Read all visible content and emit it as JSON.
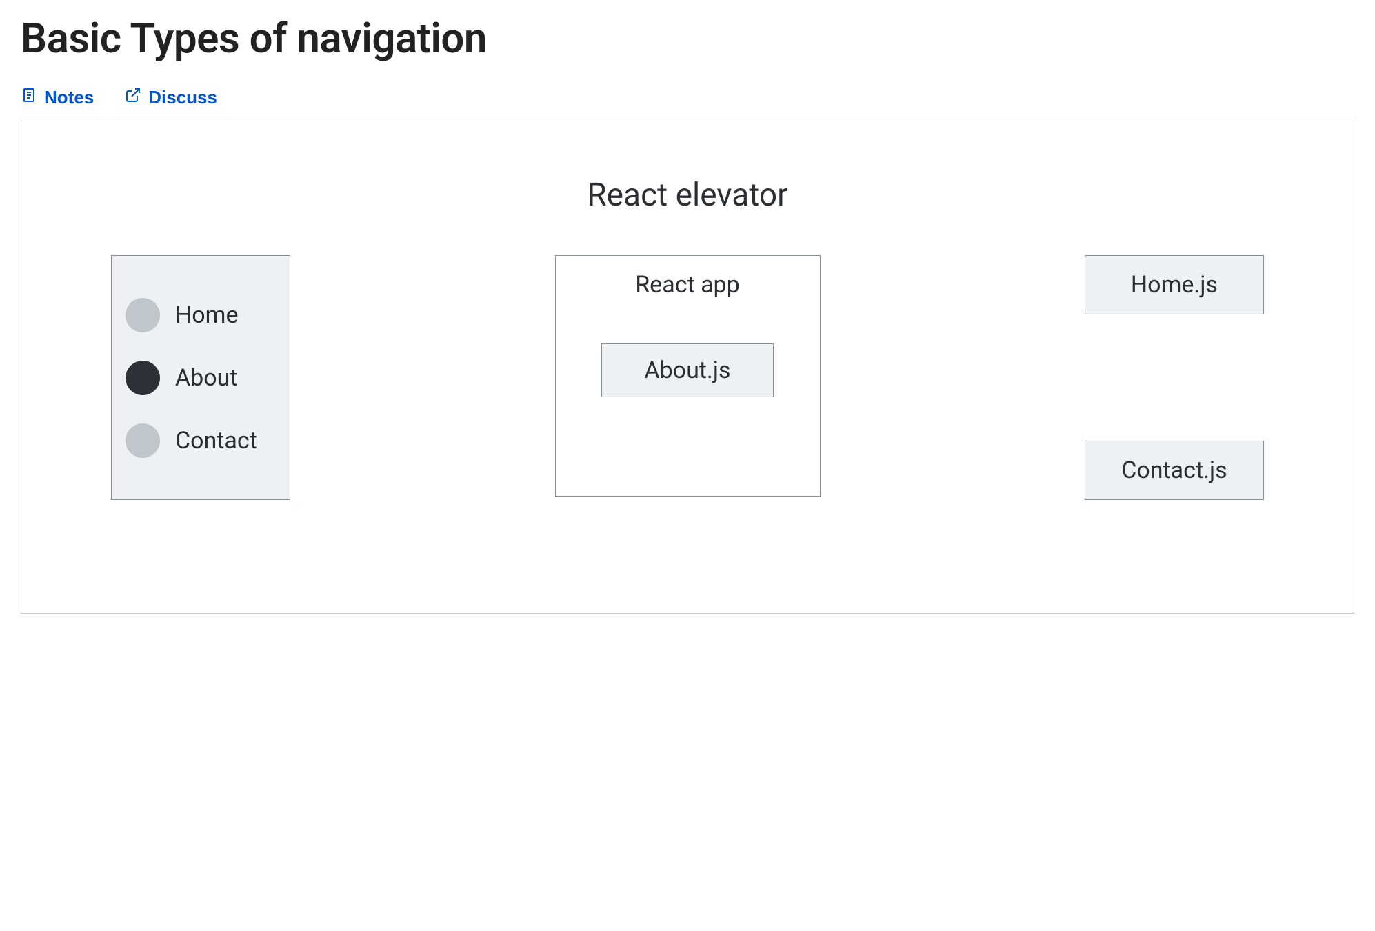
{
  "page": {
    "title": "Basic Types of navigation"
  },
  "toolbar": {
    "notes_label": "Notes",
    "discuss_label": "Discuss"
  },
  "slide": {
    "title": "React elevator",
    "nav_items": [
      {
        "label": "Home",
        "active": false
      },
      {
        "label": "About",
        "active": true
      },
      {
        "label": "Contact",
        "active": false
      }
    ],
    "app_box": {
      "title": "React app",
      "loaded_file": "About.js"
    },
    "files": [
      "Home.js",
      "Contact.js"
    ]
  }
}
